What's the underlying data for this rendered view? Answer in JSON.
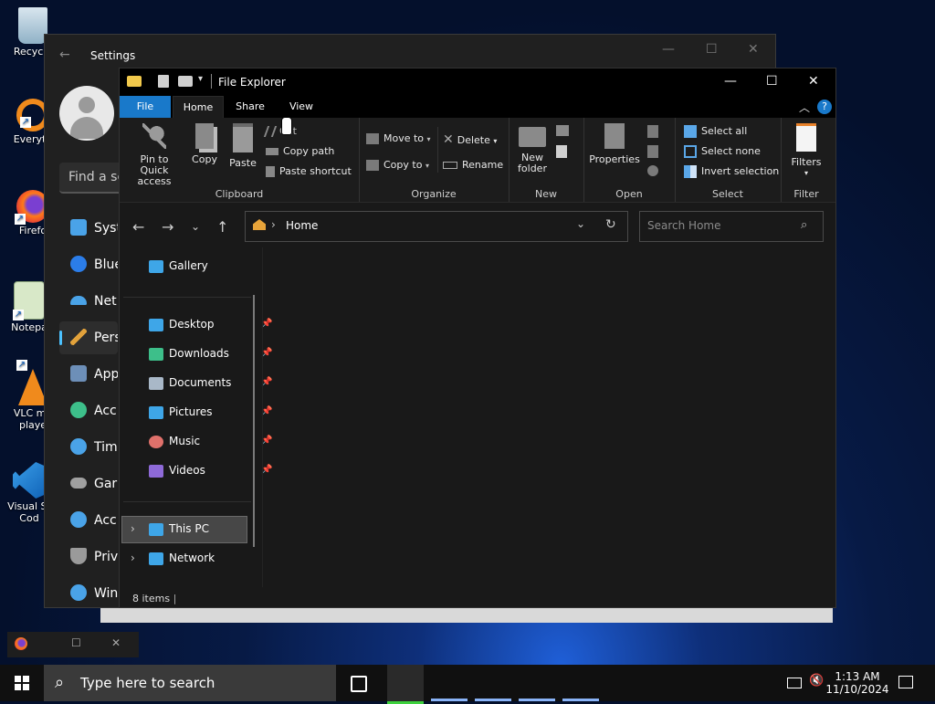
{
  "desktop": {
    "icons": [
      {
        "label": "Recycle",
        "icon": "recycle-bin-icon"
      },
      {
        "label": "Everyth",
        "icon": "everything-search-icon"
      },
      {
        "label": "Firefo",
        "icon": "firefox-icon"
      },
      {
        "label": "Notepa",
        "icon": "notepad-icon"
      },
      {
        "label": "VLC me",
        "label2": "playe",
        "icon": "vlc-icon"
      },
      {
        "label": "Visual St",
        "label2": "Cod",
        "icon": "vscode-icon"
      }
    ]
  },
  "settings": {
    "title": "Settings",
    "search_placeholder": "Find a se",
    "nav": [
      {
        "label": "Syst",
        "icon": "system-icon",
        "color": "#4aa3e8"
      },
      {
        "label": "Blue",
        "icon": "bluetooth-icon",
        "color": "#2b7de9"
      },
      {
        "label": "Net",
        "icon": "wifi-icon",
        "color": "#4aa3e8"
      },
      {
        "label": "Pers",
        "icon": "brush-icon",
        "color": "#e2a23b"
      },
      {
        "label": "App",
        "icon": "apps-icon",
        "color": "#6d8fb8"
      },
      {
        "label": "Acc",
        "icon": "account-icon",
        "color": "#3dbf8a"
      },
      {
        "label": "Tim",
        "icon": "clock-icon",
        "color": "#4aa3e8"
      },
      {
        "label": "Gar",
        "icon": "gamepad-icon",
        "color": "#a0a0a0"
      },
      {
        "label": "Acc",
        "icon": "accessibility-icon",
        "color": "#4aa3e8"
      },
      {
        "label": "Priv",
        "icon": "shield-icon",
        "color": "#9a9a9a"
      },
      {
        "label": "Win",
        "icon": "update-icon",
        "color": "#4aa3e8"
      }
    ]
  },
  "explorer": {
    "title": "File Explorer",
    "tabs": {
      "file": "File",
      "home": "Home",
      "share": "Share",
      "view": "View"
    },
    "ribbon": {
      "clipboard": {
        "label": "Clipboard",
        "pin_line1": "Pin to Quick",
        "pin_line2": "access",
        "copy": "Copy",
        "paste": "Paste",
        "cut": "Cut",
        "copy_path": "Copy path",
        "paste_shortcut": "Paste shortcut"
      },
      "organize": {
        "label": "Organize",
        "move_to": "Move to",
        "copy_to": "Copy to",
        "delete": "Delete",
        "rename": "Rename"
      },
      "new": {
        "label": "New",
        "new_folder_line1": "New",
        "new_folder_line2": "folder"
      },
      "open": {
        "label": "Open",
        "properties": "Properties"
      },
      "select": {
        "label": "Select",
        "select_all": "Select all",
        "select_none": "Select none",
        "invert": "Invert selection"
      },
      "filter": {
        "label": "Filter",
        "filters": "Filters"
      }
    },
    "address": {
      "path": "Home"
    },
    "search_placeholder": "Search Home",
    "nav": {
      "gallery": "Gallery",
      "quick": [
        {
          "label": "Desktop",
          "icon": "desktop-folder-icon",
          "color": "#3ea6e8"
        },
        {
          "label": "Downloads",
          "icon": "downloads-folder-icon",
          "color": "#3dbf8a"
        },
        {
          "label": "Documents",
          "icon": "documents-folder-icon",
          "color": "#a9b8c8"
        },
        {
          "label": "Pictures",
          "icon": "pictures-folder-icon",
          "color": "#3ea6e8"
        },
        {
          "label": "Music",
          "icon": "music-folder-icon",
          "color": "#e0716b"
        },
        {
          "label": "Videos",
          "icon": "videos-folder-icon",
          "color": "#8e6ad8"
        }
      ],
      "this_pc": "This PC",
      "network": "Network"
    },
    "status": "8 items"
  },
  "taskbar": {
    "search_placeholder": "Type here to search",
    "time": "1:13 AM",
    "date": "11/10/2024"
  }
}
